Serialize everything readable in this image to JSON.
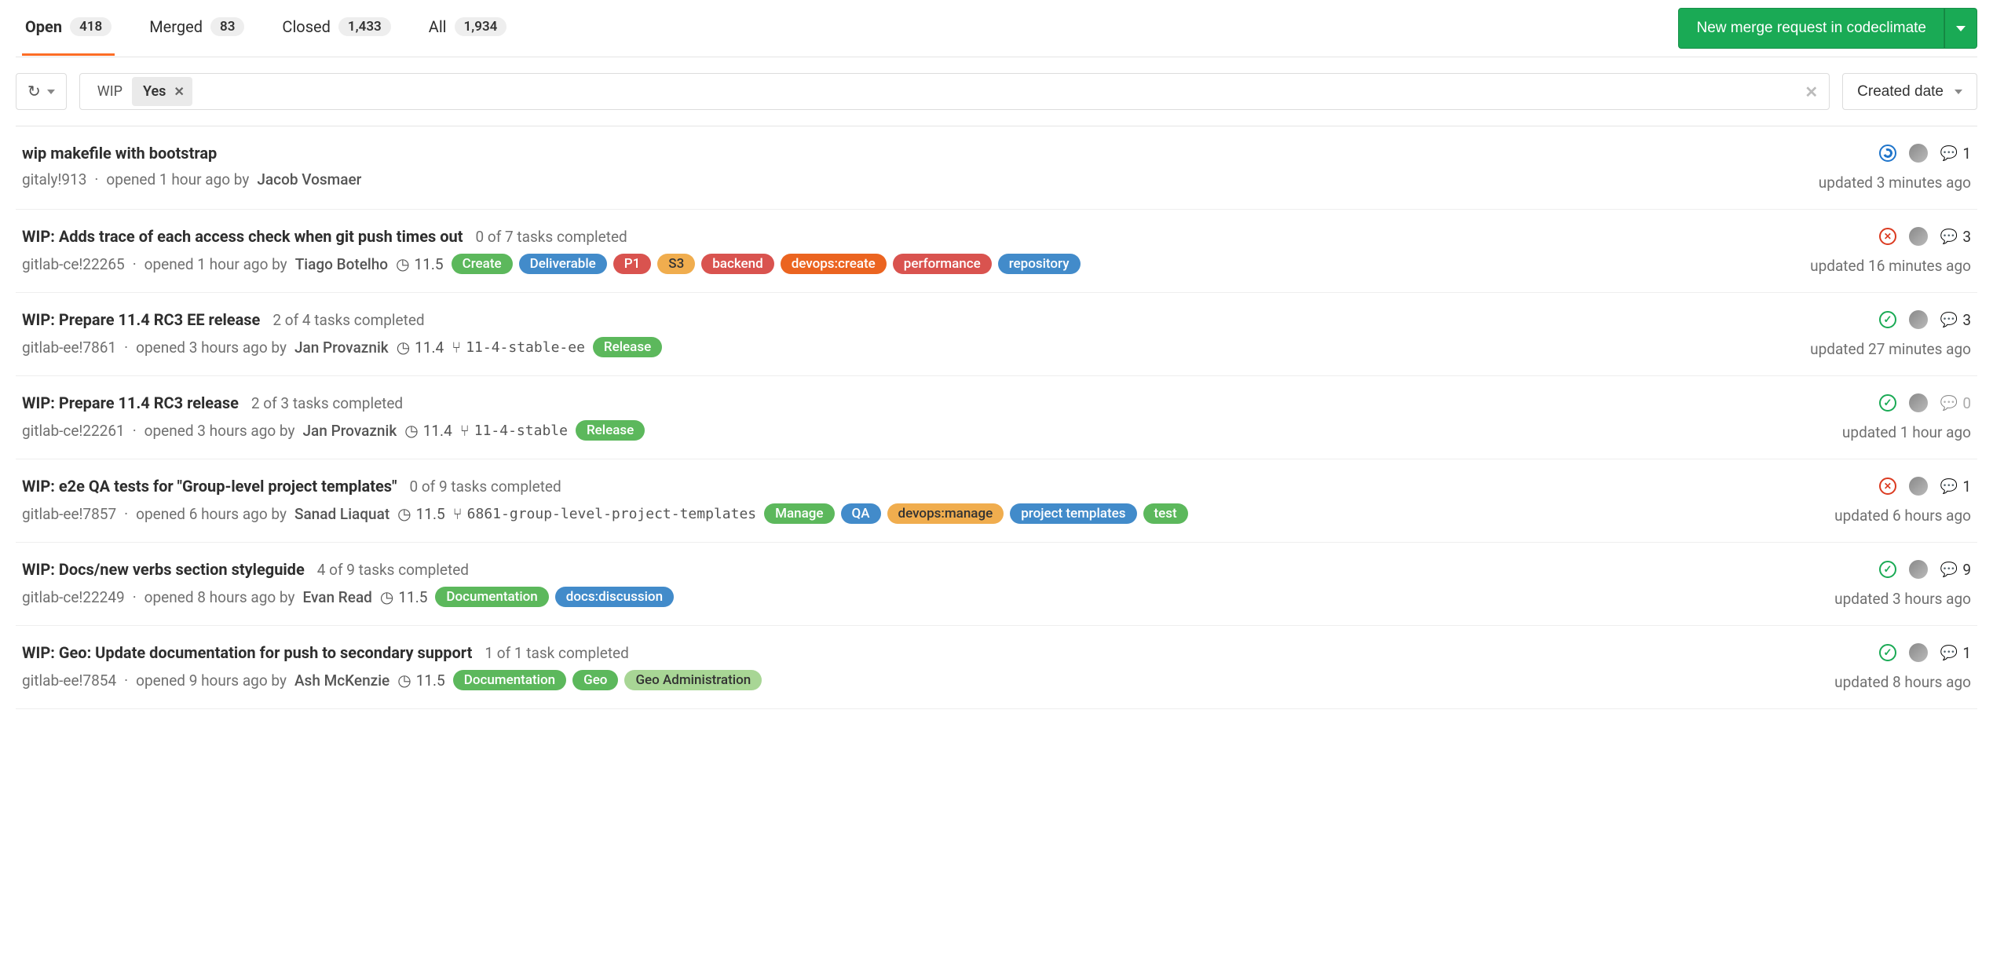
{
  "tabs": {
    "open": {
      "label": "Open",
      "count": "418"
    },
    "merged": {
      "label": "Merged",
      "count": "83"
    },
    "closed": {
      "label": "Closed",
      "count": "1,433"
    },
    "all": {
      "label": "All",
      "count": "1,934"
    }
  },
  "new_mr_button": "New merge request in codeclimate",
  "filter": {
    "token_key": "WIP",
    "token_value": "Yes"
  },
  "sort_label": "Created date",
  "label_colors": {
    "Create": "#5cb85c",
    "Deliverable": "#428bca",
    "P1": "#d9534f",
    "S3": "#f0ad4e",
    "backend": "#d9534f",
    "devops:create": "#eb6420",
    "performance": "#d9534f",
    "repository": "#428bca",
    "Release": "#5cb85c",
    "Manage": "#5cb85c",
    "QA": "#428bca",
    "devops:manage": "#f0ad4e",
    "project templates": "#428bca",
    "test": "#5cb85c",
    "Documentation": "#5cb85c",
    "docs:discussion": "#428bca",
    "Geo": "#5cb85c",
    "Geo Administration": "#a8d695"
  },
  "mrs": [
    {
      "title": "wip makefile with bootstrap",
      "tasks": "",
      "ref": "gitaly!913",
      "opened": "opened 1 hour ago by",
      "author": "Jacob Vosmaer",
      "milestone": "",
      "branch": "",
      "labels": [],
      "pipeline": "running",
      "comments": "1",
      "comments_muted": false,
      "updated": "updated 3 minutes ago"
    },
    {
      "title": "WIP: Adds trace of each access check when git push times out",
      "tasks": "0 of 7 tasks completed",
      "ref": "gitlab-ce!22265",
      "opened": "opened 1 hour ago by",
      "author": "Tiago Botelho",
      "milestone": "11.5",
      "branch": "",
      "labels": [
        "Create",
        "Deliverable",
        "P1",
        "S3",
        "backend",
        "devops:create",
        "performance",
        "repository"
      ],
      "pipeline": "failed",
      "comments": "3",
      "comments_muted": false,
      "updated": "updated 16 minutes ago"
    },
    {
      "title": "WIP: Prepare 11.4 RC3 EE release",
      "tasks": "2 of 4 tasks completed",
      "ref": "gitlab-ee!7861",
      "opened": "opened 3 hours ago by",
      "author": "Jan Provaznik",
      "milestone": "11.4",
      "branch": "11-4-stable-ee",
      "labels": [
        "Release"
      ],
      "pipeline": "passed",
      "comments": "3",
      "comments_muted": false,
      "updated": "updated 27 minutes ago"
    },
    {
      "title": "WIP: Prepare 11.4 RC3 release",
      "tasks": "2 of 3 tasks completed",
      "ref": "gitlab-ce!22261",
      "opened": "opened 3 hours ago by",
      "author": "Jan Provaznik",
      "milestone": "11.4",
      "branch": "11-4-stable",
      "labels": [
        "Release"
      ],
      "pipeline": "passed",
      "comments": "0",
      "comments_muted": true,
      "updated": "updated 1 hour ago"
    },
    {
      "title": "WIP: e2e QA tests for \"Group-level project templates\"",
      "tasks": "0 of 9 tasks completed",
      "ref": "gitlab-ee!7857",
      "opened": "opened 6 hours ago by",
      "author": "Sanad Liaquat",
      "milestone": "11.5",
      "branch": "6861-group-level-project-templates",
      "labels": [
        "Manage",
        "QA",
        "devops:manage",
        "project templates",
        "test"
      ],
      "pipeline": "failed",
      "comments": "1",
      "comments_muted": false,
      "updated": "updated 6 hours ago"
    },
    {
      "title": "WIP: Docs/new verbs section styleguide",
      "tasks": "4 of 9 tasks completed",
      "ref": "gitlab-ce!22249",
      "opened": "opened 8 hours ago by",
      "author": "Evan Read",
      "milestone": "11.5",
      "branch": "",
      "labels": [
        "Documentation",
        "docs:discussion"
      ],
      "pipeline": "passed",
      "comments": "9",
      "comments_muted": false,
      "updated": "updated 3 hours ago"
    },
    {
      "title": "WIP: Geo: Update documentation for push to secondary support",
      "tasks": "1 of 1 task completed",
      "ref": "gitlab-ee!7854",
      "opened": "opened 9 hours ago by",
      "author": "Ash McKenzie",
      "milestone": "11.5",
      "branch": "",
      "labels": [
        "Documentation",
        "Geo",
        "Geo Administration"
      ],
      "pipeline": "passed",
      "comments": "1",
      "comments_muted": false,
      "updated": "updated 8 hours ago"
    }
  ]
}
